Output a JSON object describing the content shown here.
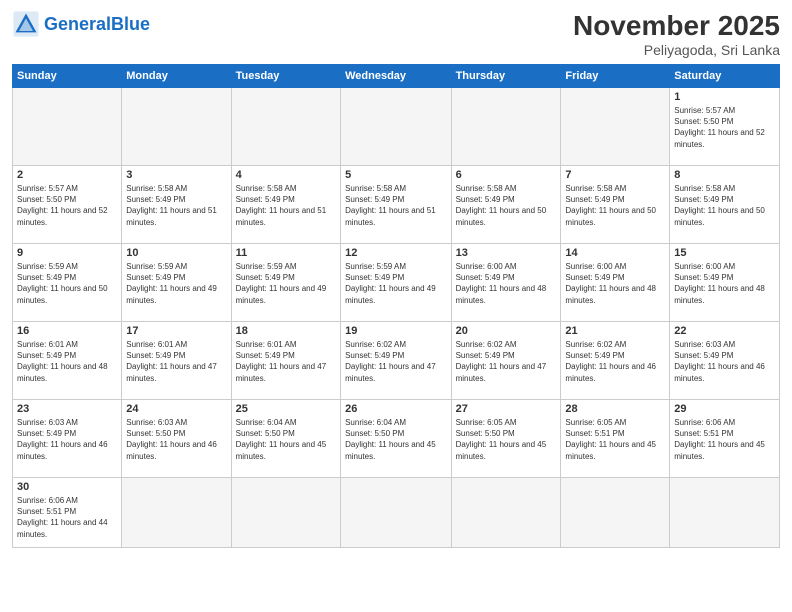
{
  "logo": {
    "text_general": "General",
    "text_blue": "Blue"
  },
  "title": {
    "month_year": "November 2025",
    "location": "Peliyagoda, Sri Lanka"
  },
  "weekdays": [
    "Sunday",
    "Monday",
    "Tuesday",
    "Wednesday",
    "Thursday",
    "Friday",
    "Saturday"
  ],
  "weeks": [
    [
      {
        "day": "",
        "sunrise": "",
        "sunset": "",
        "daylight": "",
        "empty": true
      },
      {
        "day": "",
        "sunrise": "",
        "sunset": "",
        "daylight": "",
        "empty": true
      },
      {
        "day": "",
        "sunrise": "",
        "sunset": "",
        "daylight": "",
        "empty": true
      },
      {
        "day": "",
        "sunrise": "",
        "sunset": "",
        "daylight": "",
        "empty": true
      },
      {
        "day": "",
        "sunrise": "",
        "sunset": "",
        "daylight": "",
        "empty": true
      },
      {
        "day": "",
        "sunrise": "",
        "sunset": "",
        "daylight": "",
        "empty": true
      },
      {
        "day": "1",
        "sunrise": "Sunrise: 5:57 AM",
        "sunset": "Sunset: 5:50 PM",
        "daylight": "Daylight: 11 hours and 52 minutes.",
        "empty": false
      }
    ],
    [
      {
        "day": "2",
        "sunrise": "Sunrise: 5:57 AM",
        "sunset": "Sunset: 5:50 PM",
        "daylight": "Daylight: 11 hours and 52 minutes.",
        "empty": false
      },
      {
        "day": "3",
        "sunrise": "Sunrise: 5:58 AM",
        "sunset": "Sunset: 5:49 PM",
        "daylight": "Daylight: 11 hours and 51 minutes.",
        "empty": false
      },
      {
        "day": "4",
        "sunrise": "Sunrise: 5:58 AM",
        "sunset": "Sunset: 5:49 PM",
        "daylight": "Daylight: 11 hours and 51 minutes.",
        "empty": false
      },
      {
        "day": "5",
        "sunrise": "Sunrise: 5:58 AM",
        "sunset": "Sunset: 5:49 PM",
        "daylight": "Daylight: 11 hours and 51 minutes.",
        "empty": false
      },
      {
        "day": "6",
        "sunrise": "Sunrise: 5:58 AM",
        "sunset": "Sunset: 5:49 PM",
        "daylight": "Daylight: 11 hours and 50 minutes.",
        "empty": false
      },
      {
        "day": "7",
        "sunrise": "Sunrise: 5:58 AM",
        "sunset": "Sunset: 5:49 PM",
        "daylight": "Daylight: 11 hours and 50 minutes.",
        "empty": false
      },
      {
        "day": "8",
        "sunrise": "Sunrise: 5:58 AM",
        "sunset": "Sunset: 5:49 PM",
        "daylight": "Daylight: 11 hours and 50 minutes.",
        "empty": false
      }
    ],
    [
      {
        "day": "9",
        "sunrise": "Sunrise: 5:59 AM",
        "sunset": "Sunset: 5:49 PM",
        "daylight": "Daylight: 11 hours and 50 minutes.",
        "empty": false
      },
      {
        "day": "10",
        "sunrise": "Sunrise: 5:59 AM",
        "sunset": "Sunset: 5:49 PM",
        "daylight": "Daylight: 11 hours and 49 minutes.",
        "empty": false
      },
      {
        "day": "11",
        "sunrise": "Sunrise: 5:59 AM",
        "sunset": "Sunset: 5:49 PM",
        "daylight": "Daylight: 11 hours and 49 minutes.",
        "empty": false
      },
      {
        "day": "12",
        "sunrise": "Sunrise: 5:59 AM",
        "sunset": "Sunset: 5:49 PM",
        "daylight": "Daylight: 11 hours and 49 minutes.",
        "empty": false
      },
      {
        "day": "13",
        "sunrise": "Sunrise: 6:00 AM",
        "sunset": "Sunset: 5:49 PM",
        "daylight": "Daylight: 11 hours and 48 minutes.",
        "empty": false
      },
      {
        "day": "14",
        "sunrise": "Sunrise: 6:00 AM",
        "sunset": "Sunset: 5:49 PM",
        "daylight": "Daylight: 11 hours and 48 minutes.",
        "empty": false
      },
      {
        "day": "15",
        "sunrise": "Sunrise: 6:00 AM",
        "sunset": "Sunset: 5:49 PM",
        "daylight": "Daylight: 11 hours and 48 minutes.",
        "empty": false
      }
    ],
    [
      {
        "day": "16",
        "sunrise": "Sunrise: 6:01 AM",
        "sunset": "Sunset: 5:49 PM",
        "daylight": "Daylight: 11 hours and 48 minutes.",
        "empty": false
      },
      {
        "day": "17",
        "sunrise": "Sunrise: 6:01 AM",
        "sunset": "Sunset: 5:49 PM",
        "daylight": "Daylight: 11 hours and 47 minutes.",
        "empty": false
      },
      {
        "day": "18",
        "sunrise": "Sunrise: 6:01 AM",
        "sunset": "Sunset: 5:49 PM",
        "daylight": "Daylight: 11 hours and 47 minutes.",
        "empty": false
      },
      {
        "day": "19",
        "sunrise": "Sunrise: 6:02 AM",
        "sunset": "Sunset: 5:49 PM",
        "daylight": "Daylight: 11 hours and 47 minutes.",
        "empty": false
      },
      {
        "day": "20",
        "sunrise": "Sunrise: 6:02 AM",
        "sunset": "Sunset: 5:49 PM",
        "daylight": "Daylight: 11 hours and 47 minutes.",
        "empty": false
      },
      {
        "day": "21",
        "sunrise": "Sunrise: 6:02 AM",
        "sunset": "Sunset: 5:49 PM",
        "daylight": "Daylight: 11 hours and 46 minutes.",
        "empty": false
      },
      {
        "day": "22",
        "sunrise": "Sunrise: 6:03 AM",
        "sunset": "Sunset: 5:49 PM",
        "daylight": "Daylight: 11 hours and 46 minutes.",
        "empty": false
      }
    ],
    [
      {
        "day": "23",
        "sunrise": "Sunrise: 6:03 AM",
        "sunset": "Sunset: 5:49 PM",
        "daylight": "Daylight: 11 hours and 46 minutes.",
        "empty": false
      },
      {
        "day": "24",
        "sunrise": "Sunrise: 6:03 AM",
        "sunset": "Sunset: 5:50 PM",
        "daylight": "Daylight: 11 hours and 46 minutes.",
        "empty": false
      },
      {
        "day": "25",
        "sunrise": "Sunrise: 6:04 AM",
        "sunset": "Sunset: 5:50 PM",
        "daylight": "Daylight: 11 hours and 45 minutes.",
        "empty": false
      },
      {
        "day": "26",
        "sunrise": "Sunrise: 6:04 AM",
        "sunset": "Sunset: 5:50 PM",
        "daylight": "Daylight: 11 hours and 45 minutes.",
        "empty": false
      },
      {
        "day": "27",
        "sunrise": "Sunrise: 6:05 AM",
        "sunset": "Sunset: 5:50 PM",
        "daylight": "Daylight: 11 hours and 45 minutes.",
        "empty": false
      },
      {
        "day": "28",
        "sunrise": "Sunrise: 6:05 AM",
        "sunset": "Sunset: 5:51 PM",
        "daylight": "Daylight: 11 hours and 45 minutes.",
        "empty": false
      },
      {
        "day": "29",
        "sunrise": "Sunrise: 6:06 AM",
        "sunset": "Sunset: 5:51 PM",
        "daylight": "Daylight: 11 hours and 45 minutes.",
        "empty": false
      }
    ],
    [
      {
        "day": "30",
        "sunrise": "Sunrise: 6:06 AM",
        "sunset": "Sunset: 5:51 PM",
        "daylight": "Daylight: 11 hours and 44 minutes.",
        "empty": false
      },
      {
        "day": "",
        "sunrise": "",
        "sunset": "",
        "daylight": "",
        "empty": true
      },
      {
        "day": "",
        "sunrise": "",
        "sunset": "",
        "daylight": "",
        "empty": true
      },
      {
        "day": "",
        "sunrise": "",
        "sunset": "",
        "daylight": "",
        "empty": true
      },
      {
        "day": "",
        "sunrise": "",
        "sunset": "",
        "daylight": "",
        "empty": true
      },
      {
        "day": "",
        "sunrise": "",
        "sunset": "",
        "daylight": "",
        "empty": true
      },
      {
        "day": "",
        "sunrise": "",
        "sunset": "",
        "daylight": "",
        "empty": true
      }
    ]
  ]
}
